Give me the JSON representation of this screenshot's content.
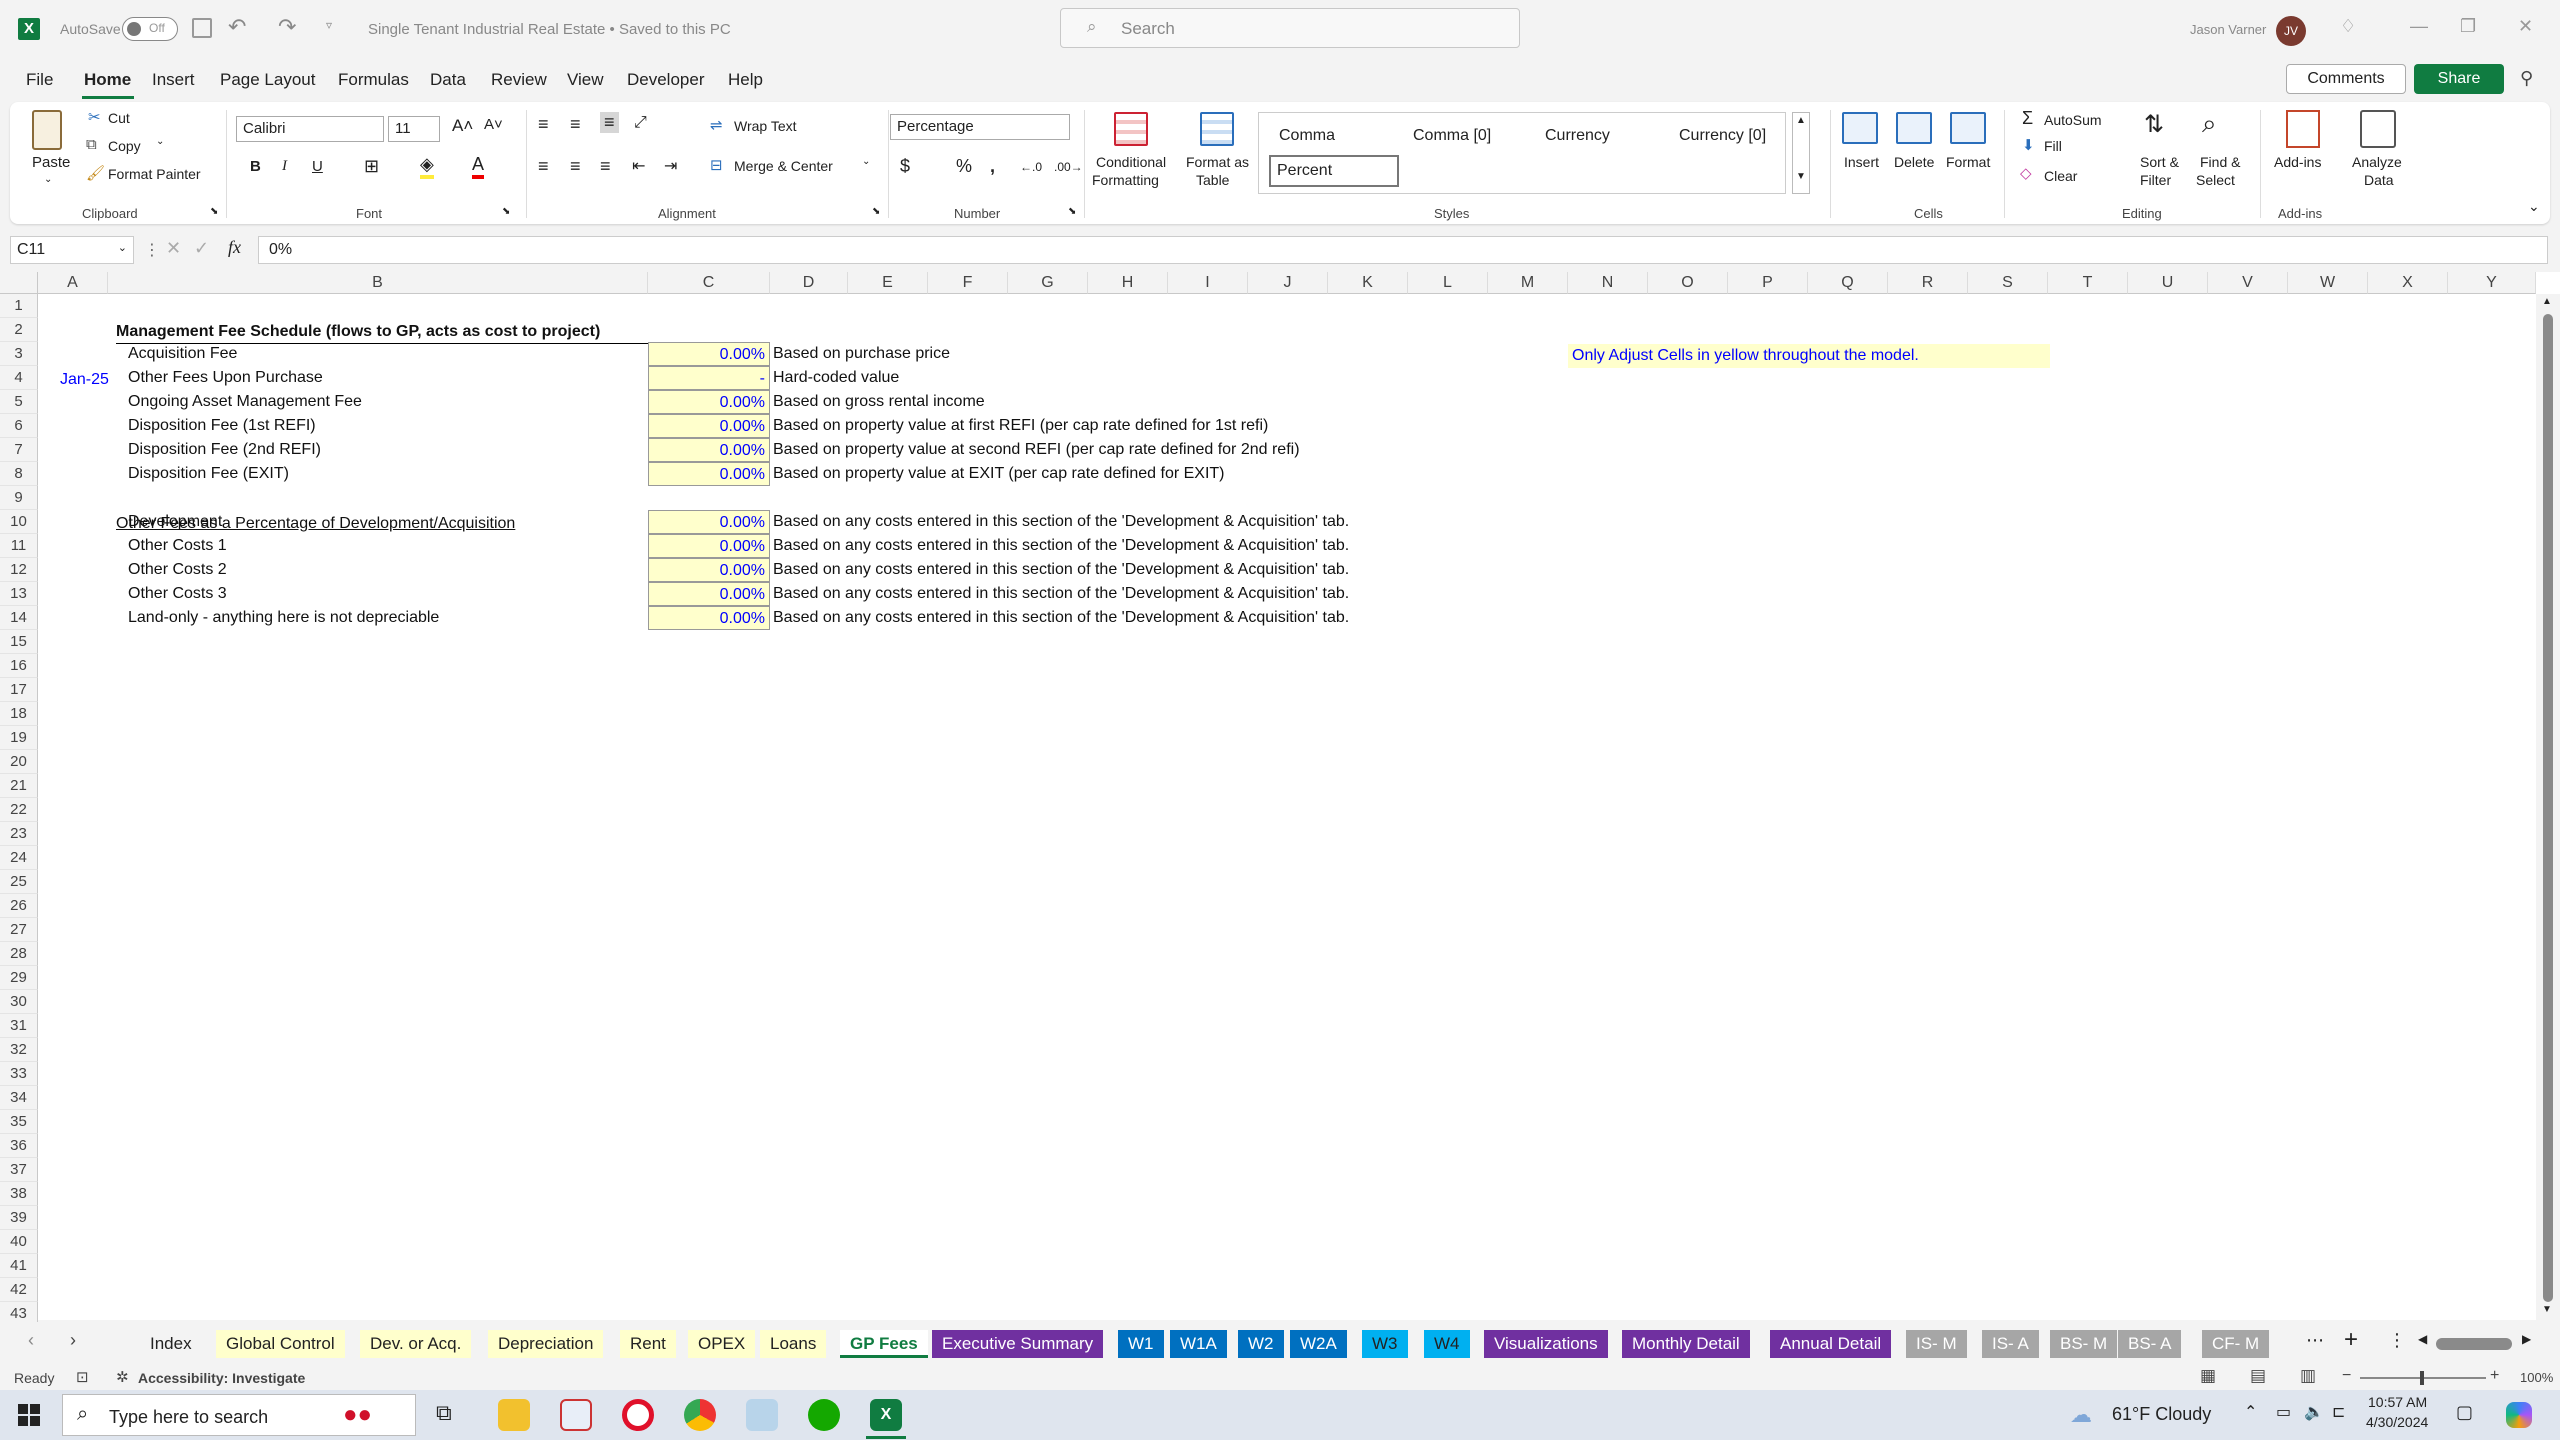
{
  "titlebar": {
    "autosave_label": "AutoSave",
    "autosave_state": "Off",
    "doc_title": "Single Tenant Industrial Real Estate • Saved to this PC",
    "search_placeholder": "Search",
    "user_name": "Jason Varner",
    "user_initials": "JV"
  },
  "menu": {
    "items": [
      "File",
      "Home",
      "Insert",
      "Page Layout",
      "Formulas",
      "Data",
      "Review",
      "View",
      "Developer",
      "Help"
    ],
    "active": "Home",
    "comments": "Comments",
    "share": "Share"
  },
  "ribbon": {
    "clipboard": {
      "paste": "Paste",
      "cut": "Cut",
      "copy": "Copy",
      "format_painter": "Format Painter",
      "label": "Clipboard"
    },
    "font": {
      "family": "Calibri",
      "size": "11",
      "label": "Font"
    },
    "alignment": {
      "wrap_text": "Wrap Text",
      "merge_center": "Merge & Center",
      "label": "Alignment"
    },
    "number": {
      "format": "Percentage",
      "label": "Number"
    },
    "styles": {
      "conditional_formatting_1": "Conditional",
      "conditional_formatting_2": "Formatting",
      "format_as_table_1": "Format as",
      "format_as_table_2": "Table",
      "cell_styles": [
        "Comma",
        "Comma [0]",
        "Currency",
        "Currency [0]",
        "Percent"
      ],
      "label": "Styles"
    },
    "cells": {
      "insert": "Insert",
      "delete": "Delete",
      "format": "Format",
      "label": "Cells"
    },
    "editing": {
      "autosum": "AutoSum",
      "fill": "Fill",
      "clear": "Clear",
      "sort_filter_1": "Sort &",
      "sort_filter_2": "Filter",
      "find_select_1": "Find &",
      "find_select_2": "Select",
      "label": "Editing"
    },
    "addins": {
      "addins": "Add-ins",
      "analyze_1": "Analyze",
      "analyze_2": "Data",
      "label": "Add-ins"
    }
  },
  "formula_bar": {
    "name_box": "C11",
    "formula": "0%"
  },
  "columns": [
    "A",
    "B",
    "C",
    "D",
    "E",
    "F",
    "G",
    "H",
    "I",
    "J",
    "K",
    "L",
    "M",
    "N",
    "O",
    "P",
    "Q",
    "R",
    "S",
    "T",
    "U",
    "V",
    "W",
    "X",
    "Y"
  ],
  "rows": [
    "1",
    "2",
    "3",
    "4",
    "5",
    "6",
    "7",
    "8",
    "9",
    "10",
    "11",
    "12",
    "13",
    "14",
    "15",
    "16",
    "17",
    "18",
    "19",
    "20",
    "21",
    "22",
    "23",
    "24",
    "25",
    "26",
    "27",
    "28",
    "29",
    "30",
    "31",
    "32",
    "33",
    "34",
    "35",
    "36",
    "37",
    "38",
    "39",
    "40",
    "41",
    "42",
    "43"
  ],
  "sheet": {
    "title": "Management Fee Schedule (flows to GP, acts as cost to project)",
    "note": "Only Adjust Cells in yellow throughout the model.",
    "a4": "Jan-25",
    "section2": "Other Fees as a Percentage of Development/Acquisition",
    "fees": [
      {
        "row": "3",
        "label": "Acquisition Fee",
        "value": "0.00%",
        "desc": "Based on purchase price"
      },
      {
        "row": "4",
        "label": "Other Fees Upon Purchase",
        "value": "-",
        "desc": "Hard-coded value"
      },
      {
        "row": "5",
        "label": "Ongoing Asset Management Fee",
        "value": "0.00%",
        "desc": "Based on gross rental income"
      },
      {
        "row": "6",
        "label": "Disposition Fee (1st REFI)",
        "value": "0.00%",
        "desc": "Based on property value at first REFI (per cap rate defined for 1st refi)"
      },
      {
        "row": "7",
        "label": "Disposition Fee (2nd REFI)",
        "value": "0.00%",
        "desc": "Based on property value at second REFI (per cap rate defined for 2nd refi)"
      },
      {
        "row": "8",
        "label": "Disposition Fee (EXIT)",
        "value": "0.00%",
        "desc": "Based on property value at EXIT (per cap rate defined for EXIT)"
      }
    ],
    "other_fees": [
      {
        "row": "10",
        "label": "Development",
        "value": "0.00%",
        "desc": "Based on any costs entered in this section of the 'Development & Acquisition' tab."
      },
      {
        "row": "11",
        "label": "Other Costs 1",
        "value": "0.00%",
        "desc": "Based on any costs entered in this section of the 'Development & Acquisition' tab."
      },
      {
        "row": "12",
        "label": "Other Costs 2",
        "value": "0.00%",
        "desc": "Based on any costs entered in this section of the 'Development & Acquisition' tab."
      },
      {
        "row": "13",
        "label": "Other Costs 3",
        "value": "0.00%",
        "desc": "Based on any costs entered in this section of the 'Development & Acquisition' tab."
      },
      {
        "row": "14",
        "label": "Land-only - anything here is not depreciable",
        "value": "0.00%",
        "desc": "Based on any costs entered in this section of the 'Development & Acquisition' tab."
      }
    ]
  },
  "tabs": [
    {
      "label": "Index",
      "bg": "#f3f3f3",
      "fg": "#222"
    },
    {
      "label": "Global Control",
      "bg": "#ffffcc",
      "fg": "#222"
    },
    {
      "label": "Dev. or Acq.",
      "bg": "#ffffcc",
      "fg": "#222"
    },
    {
      "label": "Depreciation",
      "bg": "#ffffcc",
      "fg": "#222"
    },
    {
      "label": "Rent",
      "bg": "#ffffcc",
      "fg": "#222"
    },
    {
      "label": "OPEX",
      "bg": "#ffffcc",
      "fg": "#222"
    },
    {
      "label": "Loans",
      "bg": "#ffffcc",
      "fg": "#222"
    },
    {
      "label": "GP Fees",
      "bg": "#ffffff",
      "fg": "#107c41"
    },
    {
      "label": "Executive Summary",
      "bg": "#7030a0",
      "fg": "#ffffff"
    },
    {
      "label": "W1",
      "bg": "#0070c0",
      "fg": "#ffffff"
    },
    {
      "label": "W1A",
      "bg": "#0070c0",
      "fg": "#ffffff"
    },
    {
      "label": "W2",
      "bg": "#0070c0",
      "fg": "#ffffff"
    },
    {
      "label": "W2A",
      "bg": "#0070c0",
      "fg": "#ffffff"
    },
    {
      "label": "W3",
      "bg": "#00b0f0",
      "fg": "#222"
    },
    {
      "label": "W4",
      "bg": "#00b0f0",
      "fg": "#222"
    },
    {
      "label": "Visualizations",
      "bg": "#7030a0",
      "fg": "#ffffff"
    },
    {
      "label": "Monthly Detail",
      "bg": "#7030a0",
      "fg": "#ffffff"
    },
    {
      "label": "Annual Detail",
      "bg": "#7030a0",
      "fg": "#ffffff"
    },
    {
      "label": "IS- M",
      "bg": "#a6a6a6",
      "fg": "#ffffff"
    },
    {
      "label": "IS- A",
      "bg": "#a6a6a6",
      "fg": "#ffffff"
    },
    {
      "label": "BS- M",
      "bg": "#a6a6a6",
      "fg": "#ffffff"
    },
    {
      "label": "BS- A",
      "bg": "#a6a6a6",
      "fg": "#ffffff"
    },
    {
      "label": "CF- M",
      "bg": "#a6a6a6",
      "fg": "#ffffff"
    }
  ],
  "status": {
    "ready": "Ready",
    "accessibility": "Accessibility: Investigate",
    "zoom": "100%"
  },
  "taskbar": {
    "search_placeholder": "Type here to search",
    "weather": "61°F  Cloudy",
    "time": "10:57 AM",
    "date": "4/30/2024"
  },
  "colors": {
    "accent": "#107c41",
    "input_fill": "#ffffcc",
    "input_text": "#0000ff"
  }
}
